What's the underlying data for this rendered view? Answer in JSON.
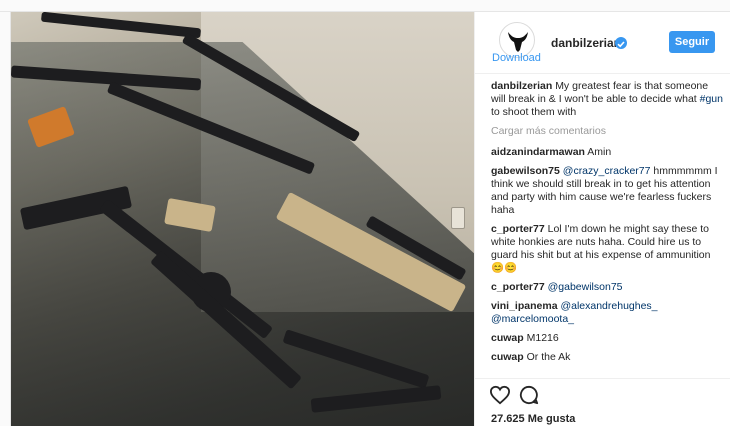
{
  "post": {
    "username": "danbilzerian",
    "download_label": "Download",
    "follow_label": "Seguir",
    "caption_user": "danbilzerian",
    "caption_text": "My greatest fear is that someone will break in & I won't be able to decide what ",
    "caption_hashtag": "#gun",
    "caption_end": " to shoot them with",
    "load_more": "Cargar más comentarios",
    "likes": "27.625 Me gusta"
  },
  "comments": [
    {
      "user": "aidzanindarmawan",
      "text": "Amin"
    },
    {
      "user": "gabewilson75",
      "mention": "@crazy_cracker77",
      "text": " hmmmmmm I think we should still break in to get his attention and party with him cause we're fearless fuckers haha"
    },
    {
      "user": "c_porter77",
      "text": "Lol I'm down he might say these to white honkies are nuts haha. Could hire us to guard his shit but at his expense of ammunition 😊😊"
    },
    {
      "user": "c_porter77",
      "mention": "@gabewilson75",
      "text": ""
    },
    {
      "user": "vini_ipanema",
      "mention": "@alexandrehughes_ @marcelomoota_",
      "text": ""
    },
    {
      "user": "cuwap",
      "text": "M1216"
    },
    {
      "user": "cuwap",
      "text": "Or the Ak"
    }
  ],
  "colors": {
    "accent": "#3897f0"
  }
}
